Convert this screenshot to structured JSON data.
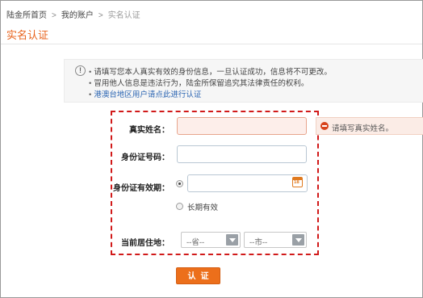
{
  "breadcrumb": {
    "home": "陆金所首页",
    "account": "我的账户",
    "current": "实名认证",
    "separator": ">"
  },
  "page": {
    "title": "实名认证"
  },
  "notice": {
    "icon": "!",
    "line1": "请填写您本人真实有效的身份信息，一旦认证成功，信息将不可更改。",
    "line2": "冒用他人信息是违法行为，陆金所保留追究其法律责任的权利。",
    "line3_link": "港澳台地区用户请点此进行认证"
  },
  "form": {
    "name_label": "真实姓名：",
    "name_value": "",
    "id_label": "身份证号码：",
    "id_value": "",
    "expire_label": "身份证有效期：",
    "expire_value": "",
    "long_term_label": "长期有效",
    "address_label": "当前居住地：",
    "province_placeholder": "--省--",
    "city_placeholder": "--市--",
    "submit_label": "认证"
  },
  "validation": {
    "name_error": "请填写真实姓名。"
  },
  "colors": {
    "accent": "#e8631c",
    "link": "#2a64b2",
    "error": "#d8441c",
    "highlight_box": "#d11a1a"
  }
}
